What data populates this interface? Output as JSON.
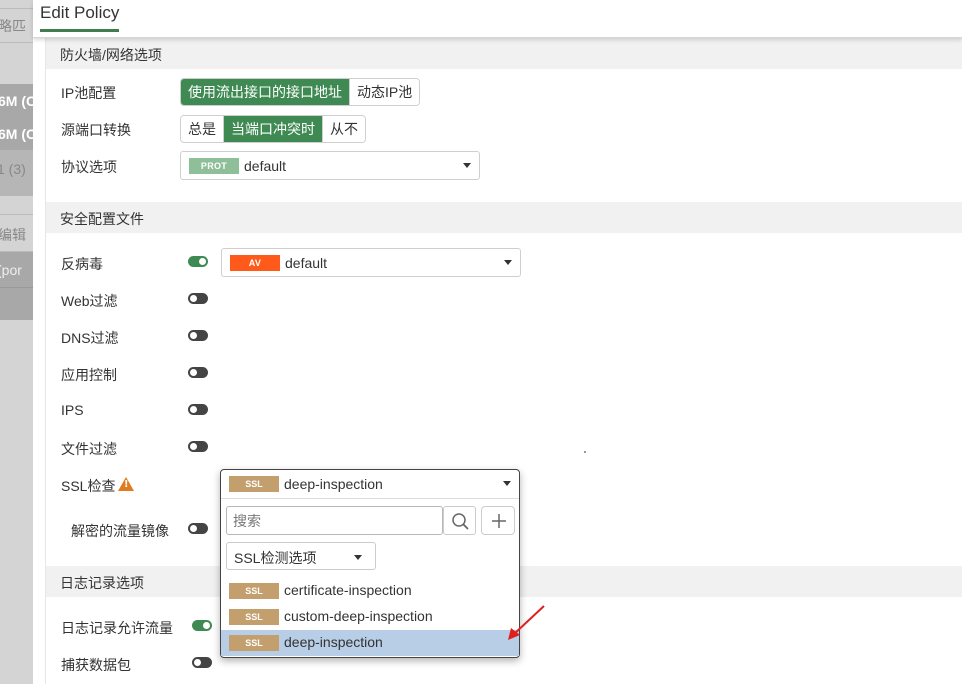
{
  "background": {
    "fragments": [
      "略匹",
      "6M (C",
      "6M (C",
      "1 (3)",
      "编辑",
      "(por"
    ]
  },
  "modal": {
    "title": "Edit Policy"
  },
  "firewall_section": {
    "title": "防火墙/网络选项",
    "ip_pool": {
      "label": "IP池配置",
      "options": [
        "使用流出接口的接口地址",
        "动态IP池"
      ],
      "active": "使用流出接口的接口地址"
    },
    "src_port": {
      "label": "源端口转换",
      "options": [
        "总是",
        "当端口冲突时",
        "从不"
      ],
      "active": "当端口冲突时"
    },
    "protocol": {
      "label": "协议选项",
      "badge": "PROT",
      "value": "default"
    }
  },
  "security_section": {
    "title": "安全配置文件",
    "antivirus": {
      "label": "反病毒",
      "enabled": true,
      "badge": "AV",
      "value": "default"
    },
    "web_filter": {
      "label": "Web过滤",
      "enabled": false
    },
    "dns_filter": {
      "label": "DNS过滤",
      "enabled": false
    },
    "app_control": {
      "label": "应用控制",
      "enabled": false
    },
    "ips": {
      "label": "IPS",
      "enabled": false
    },
    "file_filter": {
      "label": "文件过滤",
      "enabled": false
    },
    "ssl_inspection": {
      "label": "SSL检查",
      "badge": "SSL",
      "value": "deep-inspection"
    },
    "decrypted_mirror": {
      "label": "解密的流量镜像",
      "enabled": false
    }
  },
  "log_section": {
    "title": "日志记录选项",
    "log_allowed": {
      "label": "日志记录允许流量",
      "enabled": true
    },
    "capture_packets": {
      "label": "捕获数据包",
      "enabled": false
    }
  },
  "ssl_dropdown": {
    "search_placeholder": "搜索",
    "filter_label": "SSL检测选项",
    "options": [
      {
        "badge": "SSL",
        "label": "certificate-inspection",
        "selected": false
      },
      {
        "badge": "SSL",
        "label": "custom-deep-inspection",
        "selected": false
      },
      {
        "badge": "SSL",
        "label": "deep-inspection",
        "selected": true
      }
    ]
  },
  "colors": {
    "accent_green": "#3f8a53",
    "prot_badge": "#8fbf98",
    "av_badge": "#ff5a1a",
    "ssl_badge": "#c49f6e",
    "selected_row": "#b8cde6",
    "annotation_arrow": "#e02020"
  },
  "icons": {
    "warning": "warning-icon",
    "search": "search-icon",
    "plus": "plus-icon",
    "caret": "caret-down-icon",
    "annotation": "red-arrow-annotation"
  }
}
